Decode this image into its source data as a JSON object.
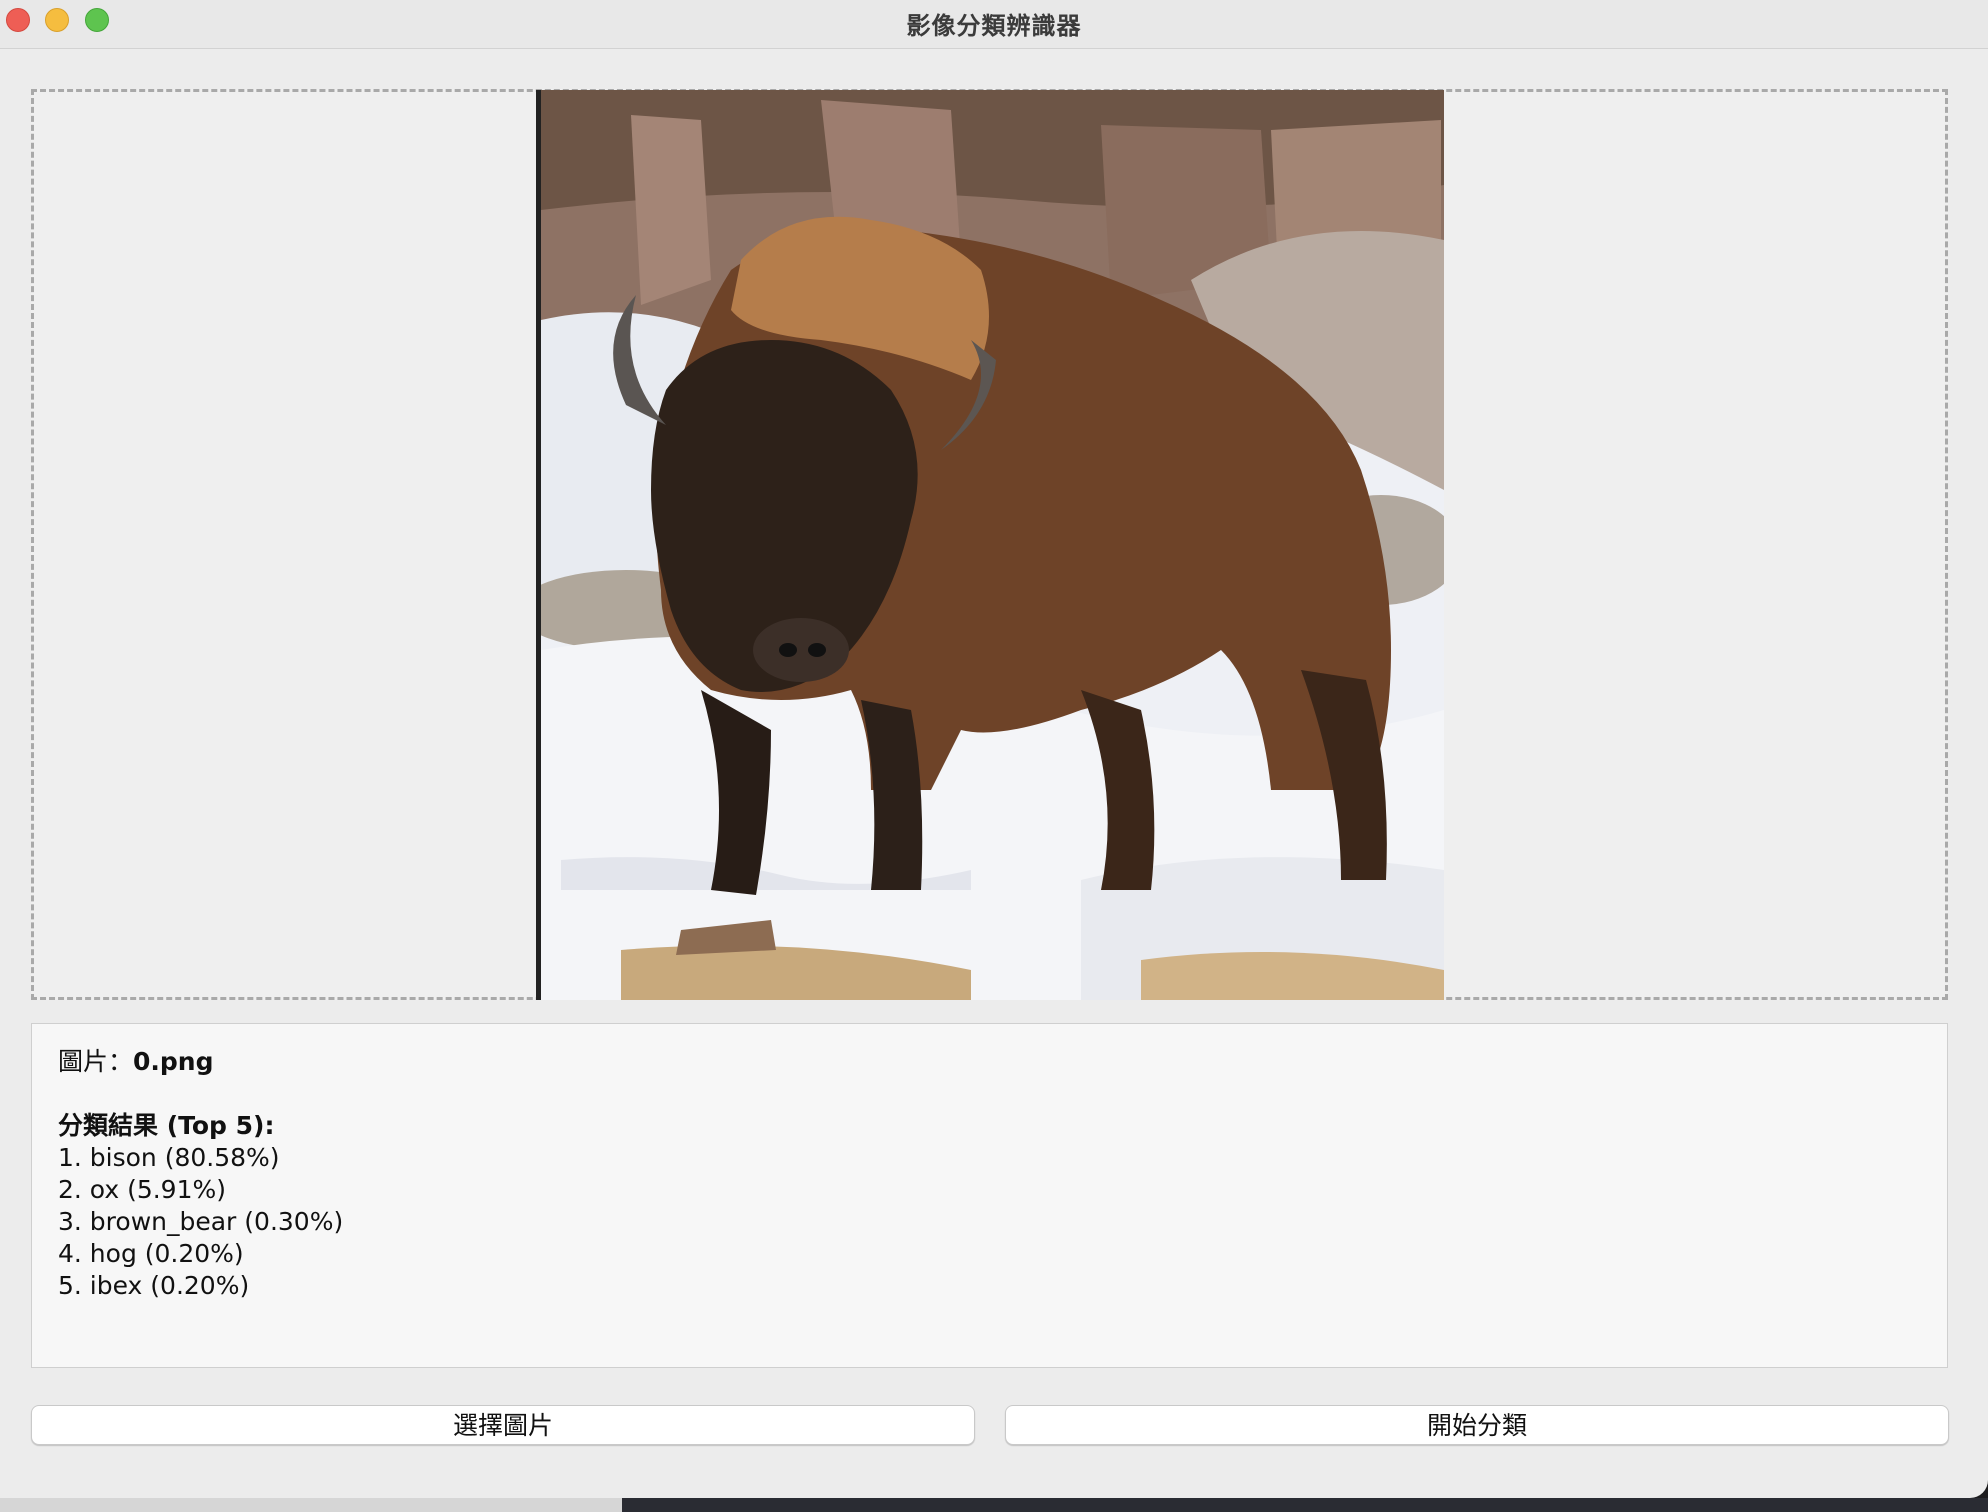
{
  "window": {
    "title": "影像分類辨識器"
  },
  "image_panel": {
    "image_alt": "bison in snow"
  },
  "results": {
    "file_label": "圖片：",
    "file_name": "0.png",
    "heading": "分類結果 (Top 5):",
    "items": [
      "1. bison (80.58%)",
      "2. ox (5.91%)",
      "3. brown_bear (0.30%)",
      "4. hog (0.20%)",
      "5. ibex (0.20%)"
    ]
  },
  "buttons": {
    "select_image": "選擇圖片",
    "start_classify": "開始分類"
  },
  "colors": {
    "close": "#ee5e55",
    "minimize": "#f5bd3f",
    "maximize": "#5ec44f"
  }
}
